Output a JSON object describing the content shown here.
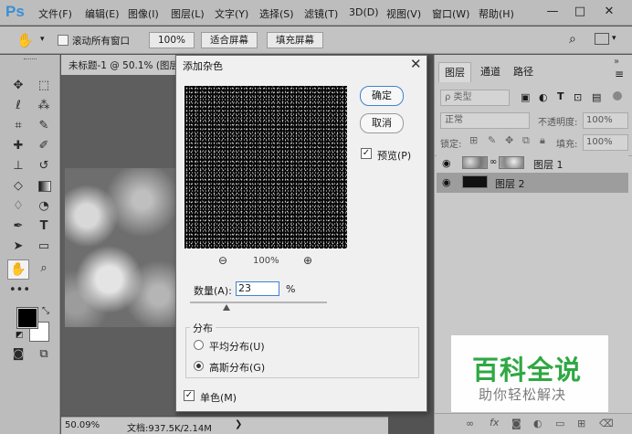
{
  "app": {
    "logo": "Ps"
  },
  "menu": [
    "文件(F)",
    "编辑(E)",
    "图像(I)",
    "图层(L)",
    "文字(Y)",
    "选择(S)",
    "滤镜(T)",
    "3D(D)",
    "视图(V)",
    "窗口(W)",
    "帮助(H)"
  ],
  "window_controls": [
    "—",
    "□",
    "✕"
  ],
  "options_bar": {
    "scroll_all_label": "滚动所有窗口",
    "zoom_value": "100%",
    "fit_screen": "适合屏幕",
    "fill_screen": "填充屏幕"
  },
  "document": {
    "tab_title": "未标题-1 @ 50.1% (图层",
    "status_zoom": "50.09%",
    "status_doc": "文档:937.5K/2.14M"
  },
  "panel": {
    "tabs": [
      "图层",
      "通道",
      "路径"
    ],
    "kind_label": "ρ 类型",
    "blend_mode": "正常",
    "opacity_label": "不透明度:",
    "opacity_value": "100%",
    "lock_label": "锁定:",
    "fill_label": "填充:",
    "fill_value": "100%",
    "layers": [
      {
        "name": "图层 1",
        "selected": false
      },
      {
        "name": "图层 2",
        "selected": true
      }
    ],
    "footer_icons": [
      "link-icon",
      "fx-icon",
      "mask-icon",
      "adjustment-icon",
      "folder-icon",
      "new-layer-icon",
      "trash-icon"
    ]
  },
  "dialog": {
    "title": "添加杂色",
    "ok": "确定",
    "cancel": "取消",
    "preview_label": "预览(P)",
    "preview_checked": true,
    "zoom_value": "100%",
    "amount_label": "数量(A):",
    "amount_value": "23",
    "amount_unit": "%",
    "amount_fraction": 0.23,
    "distribution_label": "分布",
    "uniform_label": "平均分布(U)",
    "gaussian_label": "高斯分布(G)",
    "distribution_selected": "gaussian",
    "mono_label": "单色(M)",
    "mono_checked": true
  },
  "watermark": {
    "line1": "百科全说",
    "line2": "助你轻松解决"
  },
  "colors": {
    "foreground": "#000000",
    "background": "#ffffff",
    "watermark_green": "#2fa843",
    "accent_blue": "#3c83d4"
  }
}
